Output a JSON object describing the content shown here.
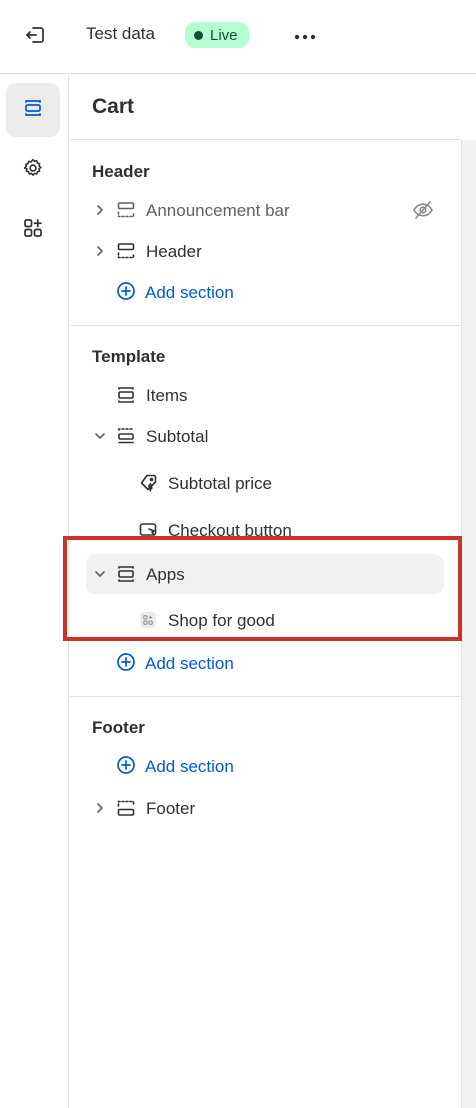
{
  "topbar": {
    "theme_name": "Test data",
    "status_badge": "Live",
    "colors": {
      "badge_bg": "#b4fed2",
      "badge_text": "#0c5132"
    }
  },
  "rail": {
    "items": [
      {
        "icon": "sections-icon",
        "active": true
      },
      {
        "icon": "gear-icon",
        "active": false
      },
      {
        "icon": "apps-add-icon",
        "active": false
      }
    ]
  },
  "panel": {
    "title": "Cart",
    "groups": {
      "header": {
        "title": "Header",
        "sections": [
          {
            "label": "Announcement bar",
            "hidden": true
          },
          {
            "label": "Header",
            "hidden": false
          }
        ],
        "add_label": "Add section"
      },
      "template": {
        "title": "Template",
        "items_label": "Items",
        "subtotal_label": "Subtotal",
        "subtotal_blocks": [
          "Subtotal price",
          "Checkout button"
        ],
        "apps_label": "Apps",
        "apps_blocks": [
          "Shop for good"
        ],
        "add_label": "Add section"
      },
      "footer": {
        "title": "Footer",
        "add_label": "Add section",
        "sections": [
          {
            "label": "Footer"
          }
        ]
      }
    }
  },
  "accent_colors": {
    "link": "#005bd3",
    "highlight_border": "#cc3329"
  }
}
